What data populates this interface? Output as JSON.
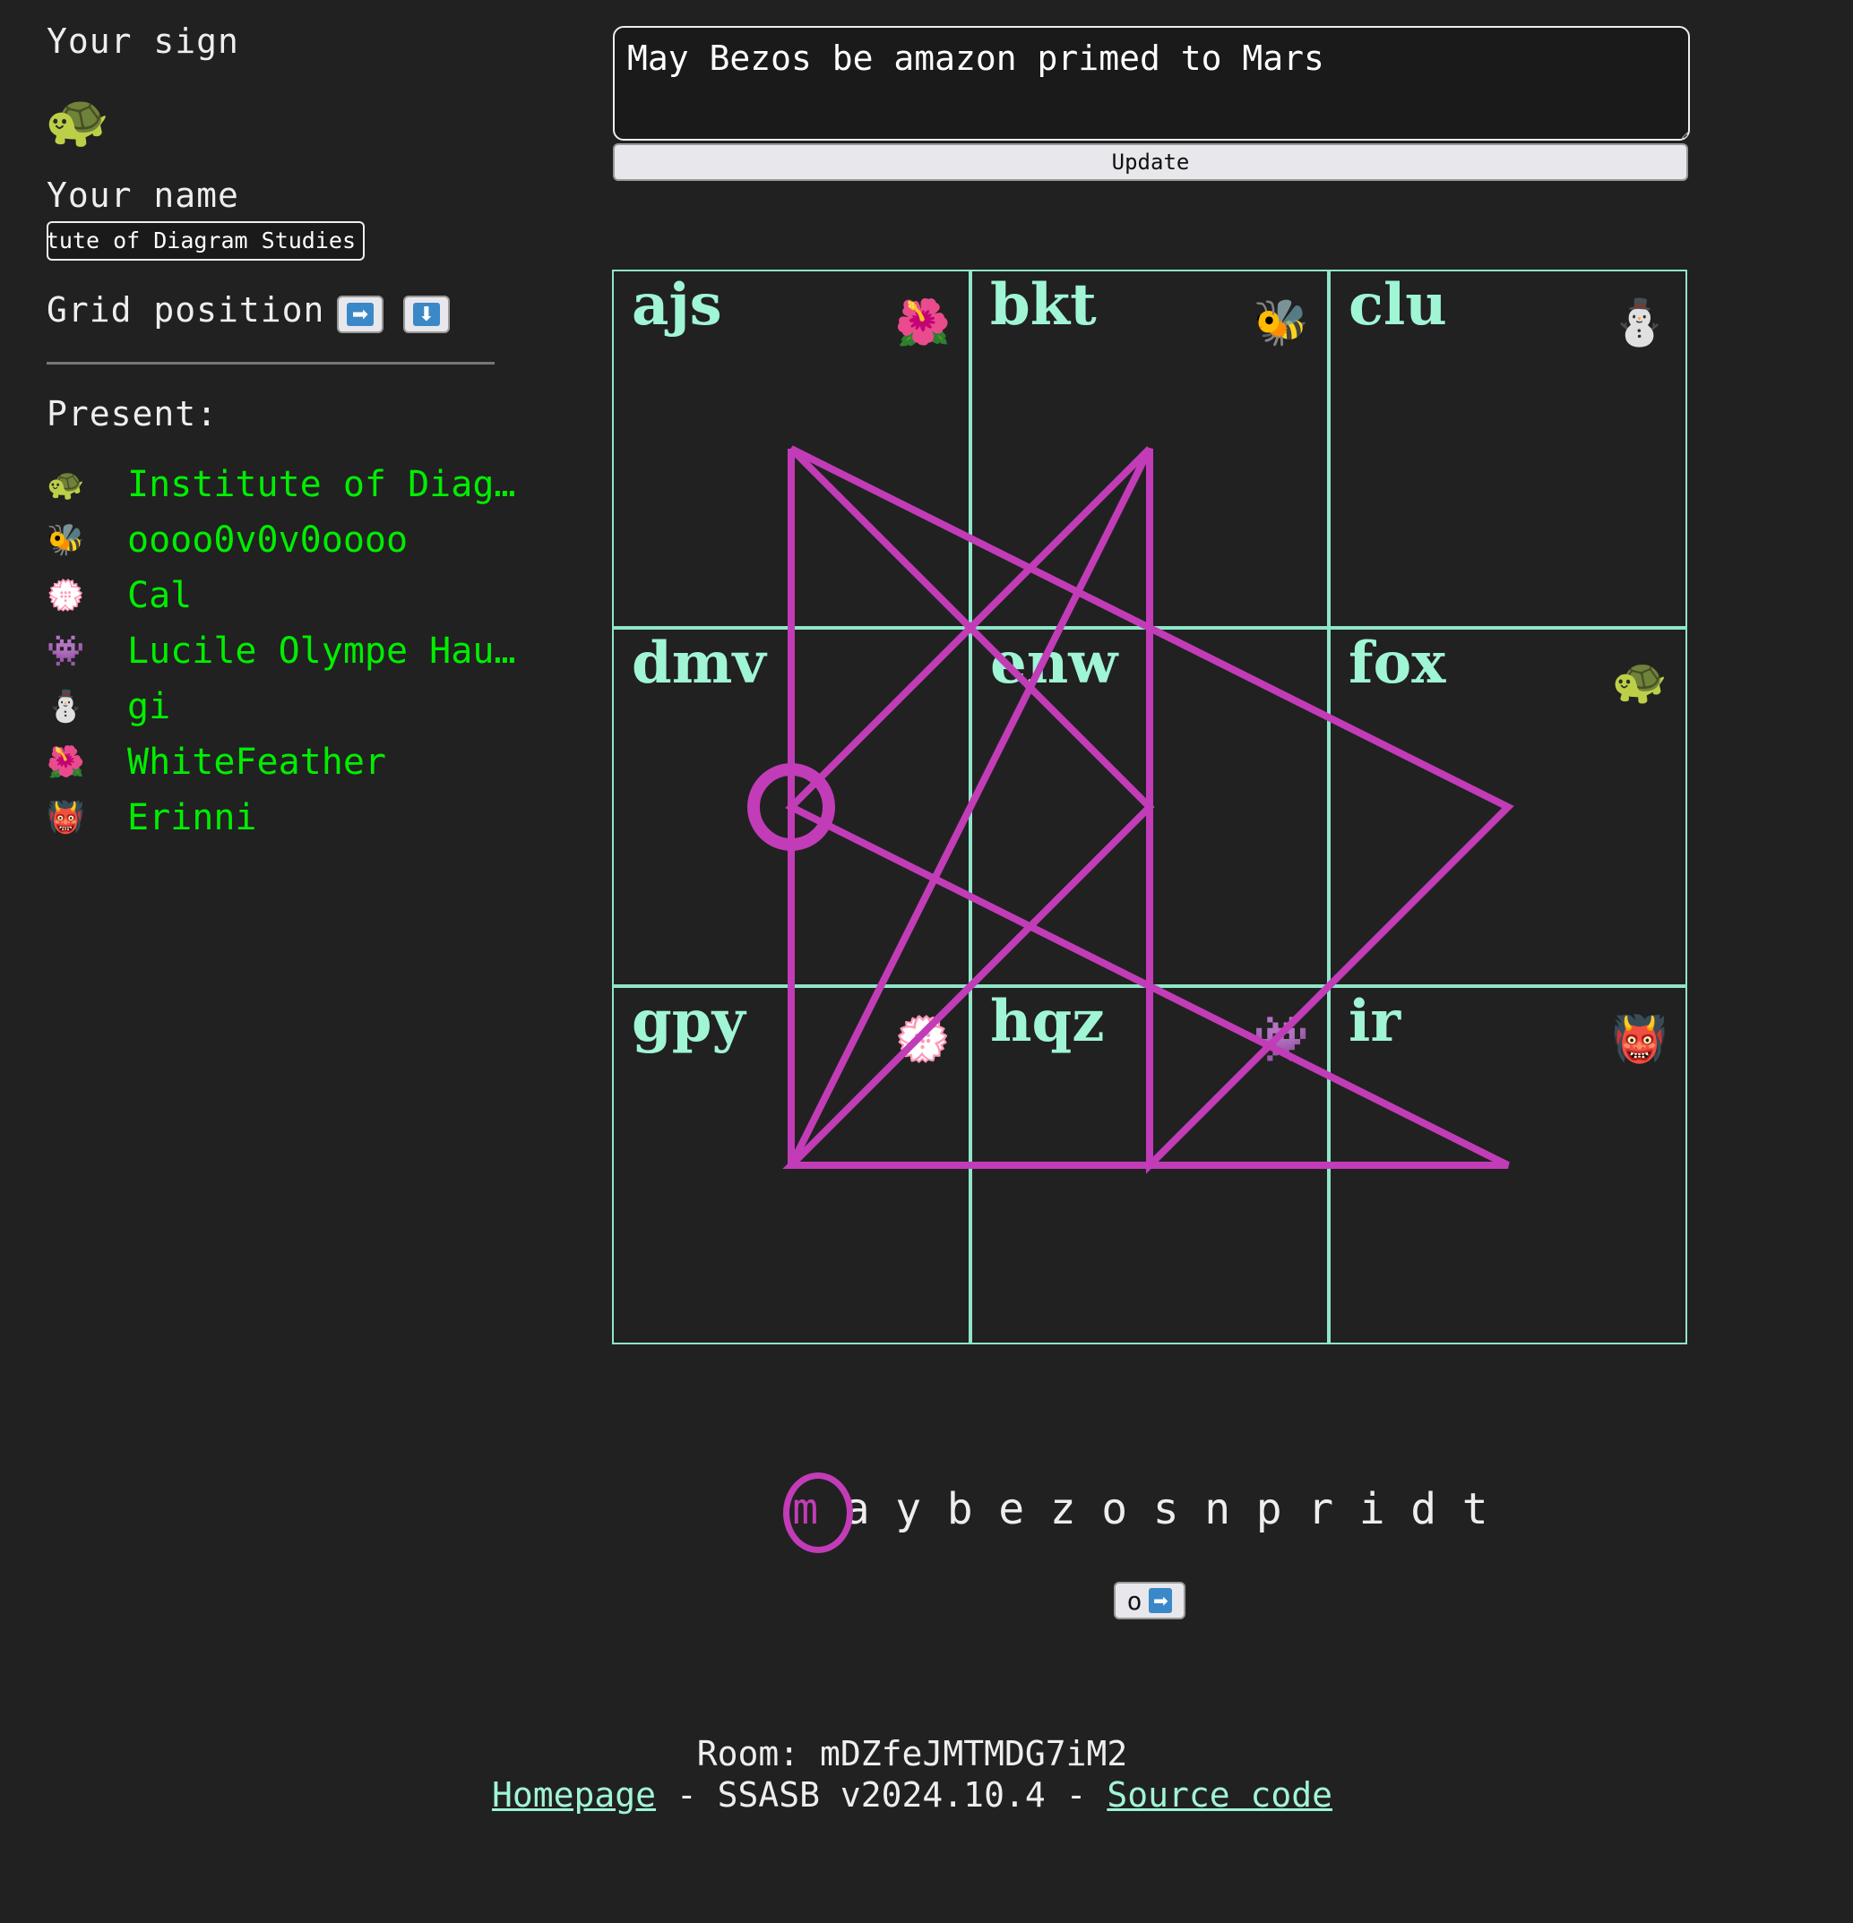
{
  "sidebar": {
    "sign_label": "Your sign",
    "sign_emoji": "🐢",
    "name_label": "Your name",
    "name_value": "Institute of Diagram Studies",
    "grid_position_label": "Grid position",
    "grid_right_icon": "➡",
    "grid_down_icon": "⬇",
    "present_label": "Present:",
    "present": [
      {
        "emoji": "🐢",
        "name": "Institute of Diag…"
      },
      {
        "emoji": "🐝",
        "name": "oooo0v0v0oooo"
      },
      {
        "emoji": "💮",
        "name": "Cal"
      },
      {
        "emoji": "👾",
        "name": "Lucile Olympe Hau…"
      },
      {
        "emoji": "⛄",
        "name": "gi"
      },
      {
        "emoji": "🌺",
        "name": "WhiteFeather"
      },
      {
        "emoji": "👹",
        "name": "Erinni"
      }
    ]
  },
  "message": {
    "value": "May Bezos be amazon primed to Mars",
    "update_label": "Update"
  },
  "grid": {
    "cells": [
      {
        "label": "ajs",
        "emoji": "🌺"
      },
      {
        "label": "bkt",
        "emoji": "🐝"
      },
      {
        "label": "clu",
        "emoji": "⛄"
      },
      {
        "label": "dmv",
        "emoji": ""
      },
      {
        "label": "enw",
        "emoji": ""
      },
      {
        "label": "fox",
        "emoji": "🐢"
      },
      {
        "label": "gpy",
        "emoji": "💮"
      },
      {
        "label": "hqz",
        "emoji": "👾"
      },
      {
        "label": "ir",
        "emoji": "👹"
      }
    ],
    "line_color": "#c23cb8",
    "border_color": "#8fe6c8"
  },
  "sigil": {
    "letters": [
      "m",
      "a",
      "y",
      "b",
      "e",
      "z",
      "o",
      "s",
      "n",
      "p",
      "r",
      "i",
      "d",
      "t"
    ],
    "current_index": 0,
    "next_button_letter": "o",
    "next_button_icon": "➡"
  },
  "footer": {
    "room": "Room: mDZfeJMTMDG7iM2",
    "homepage": "Homepage",
    "version": " - SSASB v2024.10.4 - ",
    "source": "Source code"
  }
}
